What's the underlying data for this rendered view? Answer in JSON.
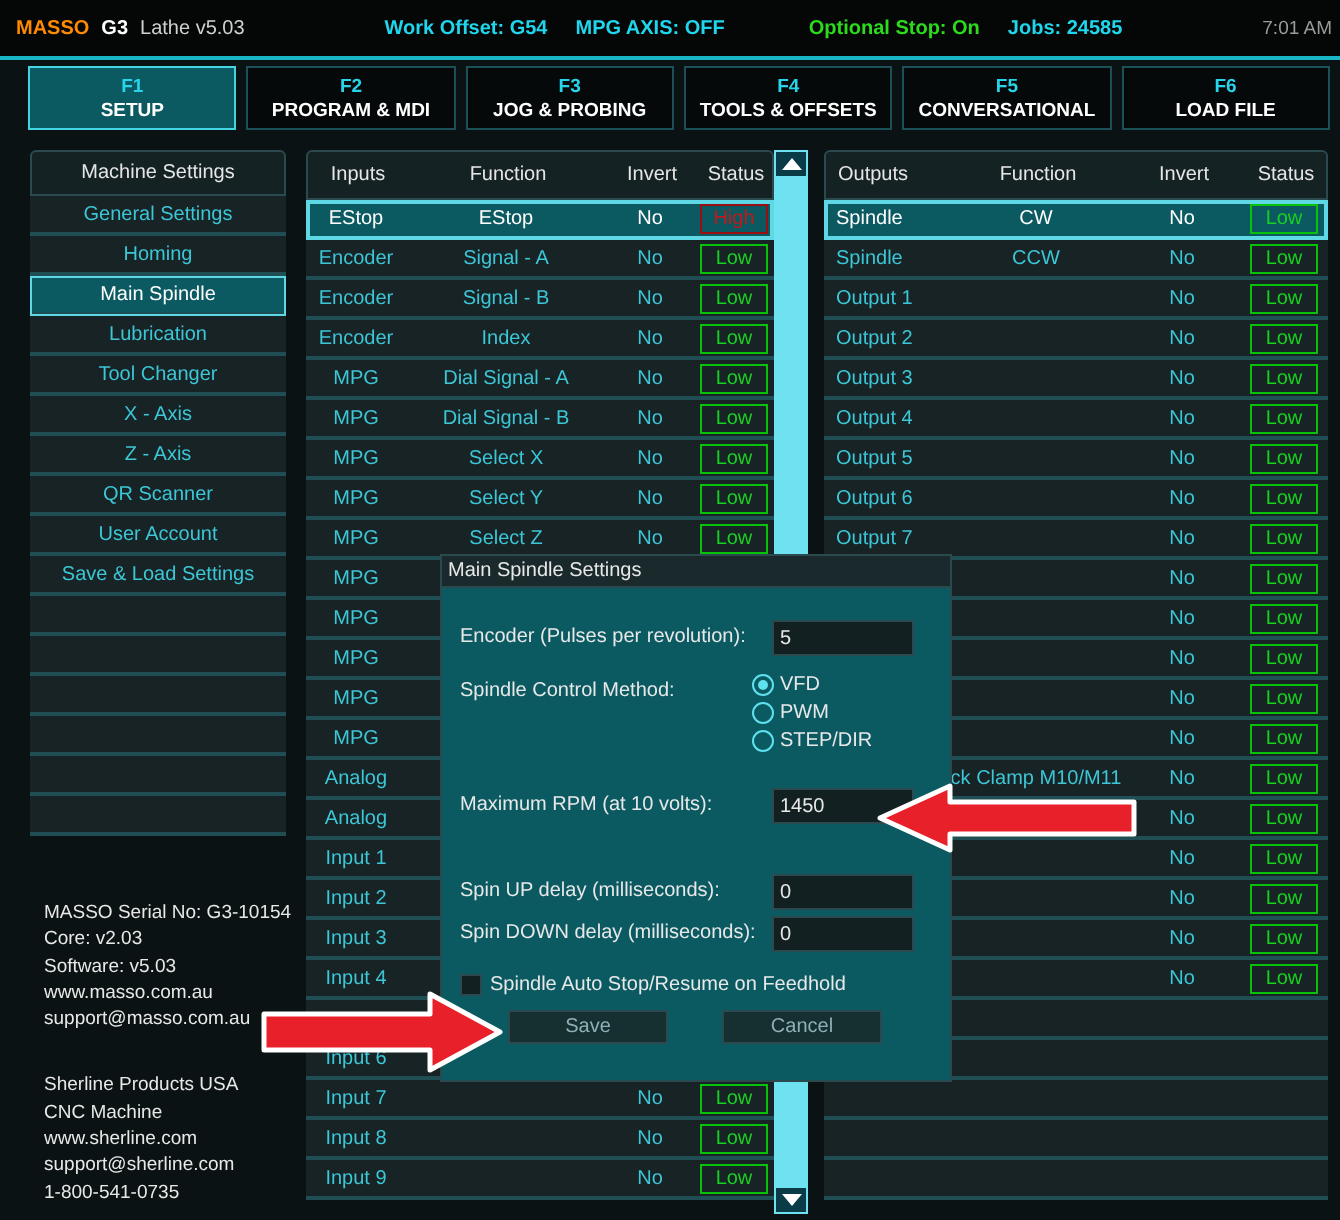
{
  "top_bar": {
    "brand": "MASSO",
    "model": "G3",
    "version": "Lathe v5.03",
    "work_offset": "Work Offset: G54",
    "mpg_axis": "MPG AXIS: OFF",
    "optional_stop": "Optional Stop: On",
    "jobs": "Jobs: 24585",
    "time": "7:01 AM"
  },
  "tabs": [
    {
      "key": "F1",
      "label": "SETUP",
      "selected": true
    },
    {
      "key": "F2",
      "label": "PROGRAM & MDI",
      "selected": false
    },
    {
      "key": "F3",
      "label": "JOG & PROBING",
      "selected": false
    },
    {
      "key": "F4",
      "label": "TOOLS & OFFSETS",
      "selected": false
    },
    {
      "key": "F5",
      "label": "CONVERSATIONAL",
      "selected": false
    },
    {
      "key": "F6",
      "label": "LOAD FILE",
      "selected": false
    }
  ],
  "sidebar": {
    "header": "Machine Settings",
    "items": [
      {
        "label": "General Settings",
        "selected": false
      },
      {
        "label": "Homing",
        "selected": false
      },
      {
        "label": "Main Spindle",
        "selected": true
      },
      {
        "label": "Lubrication",
        "selected": false
      },
      {
        "label": "Tool Changer",
        "selected": false
      },
      {
        "label": "X - Axis",
        "selected": false
      },
      {
        "label": "Z - Axis",
        "selected": false
      },
      {
        "label": "QR Scanner",
        "selected": false
      },
      {
        "label": "User Account",
        "selected": false
      },
      {
        "label": "Save & Load Settings",
        "selected": false
      }
    ]
  },
  "info": {
    "controller": [
      "MASSO Serial No: G3-10154",
      "Core: v2.03",
      "Software: v5.03",
      "www.masso.com.au",
      "support@masso.com.au"
    ],
    "vendor": [
      "Sherline Products USA",
      "CNC Machine",
      "www.sherline.com",
      "support@sherline.com",
      "1-800-541-0735"
    ]
  },
  "inputs": {
    "columns": [
      "Inputs",
      "Function",
      "Invert",
      "Status"
    ],
    "rows": [
      {
        "input": "EStop",
        "function": "EStop",
        "invert": "No",
        "status": "High",
        "high": true,
        "selected": true
      },
      {
        "input": "Encoder",
        "function": "Signal - A",
        "invert": "No",
        "status": "Low",
        "high": false,
        "selected": false
      },
      {
        "input": "Encoder",
        "function": "Signal - B",
        "invert": "No",
        "status": "Low",
        "high": false,
        "selected": false
      },
      {
        "input": "Encoder",
        "function": "Index",
        "invert": "No",
        "status": "Low",
        "high": false,
        "selected": false
      },
      {
        "input": "MPG",
        "function": "Dial Signal - A",
        "invert": "No",
        "status": "Low",
        "high": false,
        "selected": false
      },
      {
        "input": "MPG",
        "function": "Dial Signal - B",
        "invert": "No",
        "status": "Low",
        "high": false,
        "selected": false
      },
      {
        "input": "MPG",
        "function": "Select X",
        "invert": "No",
        "status": "Low",
        "high": false,
        "selected": false
      },
      {
        "input": "MPG",
        "function": "Select Y",
        "invert": "No",
        "status": "Low",
        "high": false,
        "selected": false
      },
      {
        "input": "MPG",
        "function": "Select Z",
        "invert": "No",
        "status": "Low",
        "high": false,
        "selected": false
      },
      {
        "input": "MPG"
      },
      {
        "input": "MPG"
      },
      {
        "input": "MPG"
      },
      {
        "input": "MPG"
      },
      {
        "input": "MPG"
      },
      {
        "input": "Analog"
      },
      {
        "input": "Analog"
      },
      {
        "input": "Input 1"
      },
      {
        "input": "Input 2"
      },
      {
        "input": "Input 3"
      },
      {
        "input": "Input 4"
      },
      {},
      {
        "input": "Input 6"
      },
      {
        "input": "Input 7",
        "invert": "No",
        "status": "Low",
        "high": false,
        "selected": false
      },
      {
        "input": "Input 8",
        "invert": "No",
        "status": "Low",
        "high": false,
        "selected": false
      },
      {
        "input": "Input 9",
        "invert": "No",
        "status": "Low",
        "high": false,
        "selected": false
      }
    ]
  },
  "outputs": {
    "columns": [
      "Outputs",
      "Function",
      "Invert",
      "Status"
    ],
    "rows": [
      {
        "output": "Spindle",
        "function": "CW",
        "invert": "No",
        "status": "Low",
        "high": false,
        "selected": true
      },
      {
        "output": "Spindle",
        "function": "CCW",
        "invert": "No",
        "status": "Low",
        "high": false,
        "selected": false
      },
      {
        "output": "Output 1",
        "invert": "No",
        "status": "Low",
        "high": false,
        "selected": false
      },
      {
        "output": "Output 2",
        "invert": "No",
        "status": "Low",
        "high": false,
        "selected": false
      },
      {
        "output": "Output 3",
        "invert": "No",
        "status": "Low",
        "high": false,
        "selected": false
      },
      {
        "output": "Output 4",
        "invert": "No",
        "status": "Low",
        "high": false,
        "selected": false
      },
      {
        "output": "Output 5",
        "invert": "No",
        "status": "Low",
        "high": false,
        "selected": false
      },
      {
        "output": "Output 6",
        "invert": "No",
        "status": "Low",
        "high": false,
        "selected": false
      },
      {
        "output": "Output 7",
        "invert": "No",
        "status": "Low",
        "high": false,
        "selected": false
      },
      {
        "invert": "No",
        "status": "Low",
        "high": false,
        "selected": false
      },
      {
        "invert": "No",
        "status": "Low",
        "high": false,
        "selected": false
      },
      {
        "invert": "No",
        "status": "Low",
        "high": false,
        "selected": false
      },
      {
        "invert": "No",
        "status": "Low",
        "high": false,
        "selected": false
      },
      {
        "invert": "No",
        "status": "Low",
        "high": false,
        "selected": false
      },
      {
        "function": "ck Clamp M10/M11",
        "invert": "No",
        "status": "Low",
        "high": false,
        "selected": false
      },
      {
        "invert": "No",
        "status": "Low",
        "high": false,
        "selected": false
      },
      {
        "invert": "No",
        "status": "Low",
        "high": false,
        "selected": false
      },
      {
        "invert": "No",
        "status": "Low",
        "high": false,
        "selected": false
      },
      {
        "invert": "No",
        "status": "Low",
        "high": false,
        "selected": false
      },
      {
        "invert": "No",
        "status": "Low",
        "high": false,
        "selected": false
      }
    ]
  },
  "dialog": {
    "title": "Main Spindle Settings",
    "items": [
      {
        "kind": "number",
        "label": "Encoder (Pulses per revolution):",
        "value": "5"
      },
      {
        "kind": "radio",
        "label": "Spindle Control Method:",
        "options": [
          {
            "label": "VFD",
            "selected": true
          },
          {
            "label": "PWM",
            "selected": false
          },
          {
            "label": "STEP/DIR",
            "selected": false
          }
        ]
      },
      {
        "kind": "number",
        "label": "Maximum RPM (at 10 volts):",
        "value": "1450"
      },
      {
        "kind": "number",
        "label": "Spin UP delay (milliseconds):",
        "value": "0"
      },
      {
        "kind": "number",
        "label": "Spin DOWN delay (milliseconds):",
        "value": "0"
      },
      {
        "kind": "checkbox",
        "label": "Spindle Auto Stop/Resume on Feedhold",
        "checked": false
      }
    ],
    "buttons": [
      "Save",
      "Cancel"
    ]
  }
}
